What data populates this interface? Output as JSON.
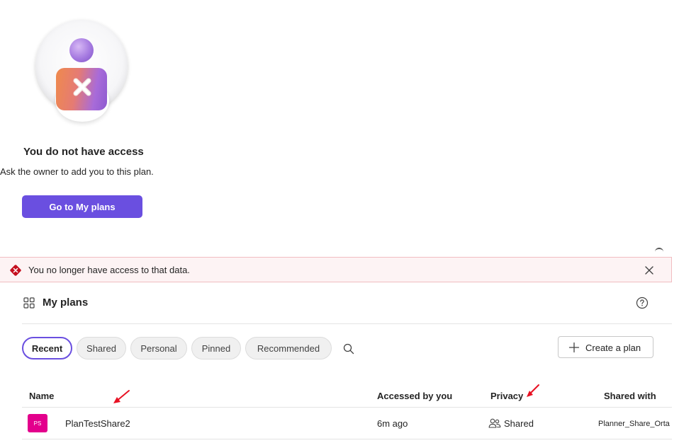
{
  "no_access": {
    "title": "You do not have access",
    "subtitle": "Ask the owner to add you to this plan.",
    "button_label": "Go to My plans"
  },
  "error_bar": {
    "message": "You no longer have access to that data.",
    "icon": "error-diamond-icon",
    "close_icon": "close-icon"
  },
  "header": {
    "title": "My plans",
    "icon": "grid-icon",
    "help_icon": "help-circle-icon"
  },
  "filters": {
    "chips": [
      "Recent",
      "Shared",
      "Personal",
      "Pinned",
      "Recommended"
    ],
    "active": "Recent",
    "search_icon": "search-icon"
  },
  "create_button": {
    "label": "Create a plan",
    "icon": "plus-icon"
  },
  "table": {
    "columns": [
      "Name",
      "Accessed by you",
      "Privacy",
      "Shared with"
    ],
    "rows": [
      {
        "avatar": "PS",
        "name": "PlanTestShare2",
        "accessed": "6m ago",
        "privacy": "Shared",
        "shared_with": "Planner_Share_Orta"
      }
    ]
  },
  "colors": {
    "accent": "#6a4fe0",
    "avatar": "#e3008c",
    "error_bg": "#fdf3f4",
    "error_icon": "#c50f1f",
    "annotation_arrow": "#e81123"
  }
}
